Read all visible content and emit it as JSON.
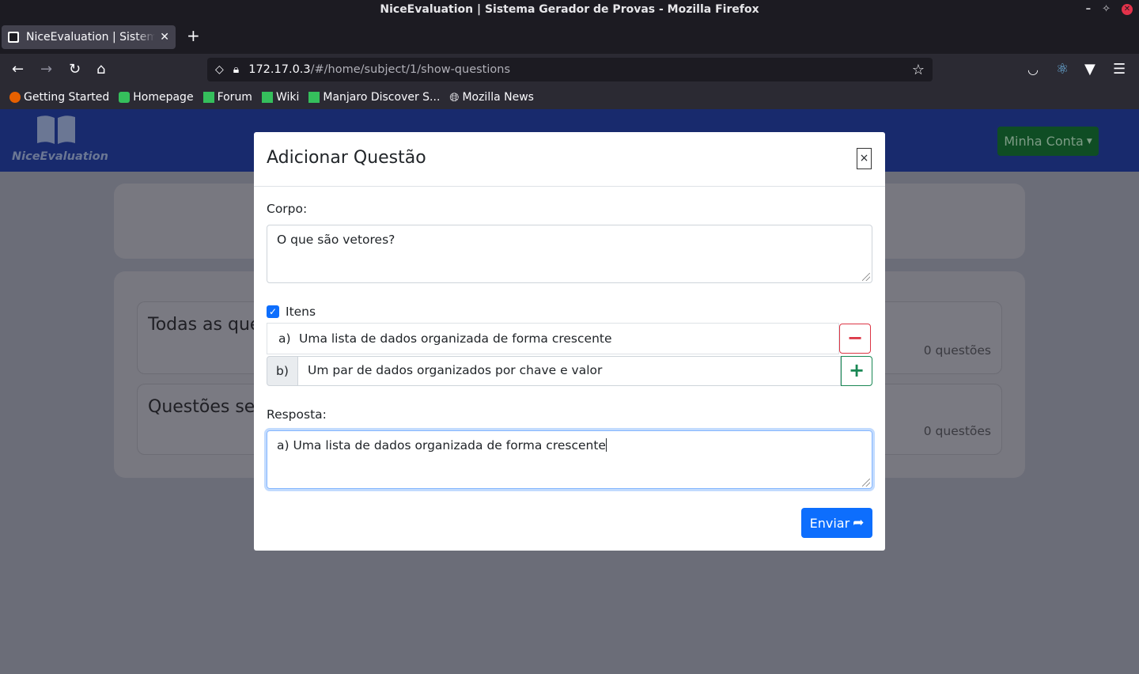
{
  "window": {
    "title": "NiceEvaluation | Sistema Gerador de Provas - Mozilla Firefox"
  },
  "browser": {
    "tab_title": "NiceEvaluation | Sistema Gerador de Provas",
    "url_host": "172.17.0.3",
    "url_path": "/#/home/subject/1/show-questions",
    "bookmarks": [
      {
        "label": "Getting Started",
        "icon": "firefox-icon"
      },
      {
        "label": "Homepage",
        "icon": "manjaro-icon"
      },
      {
        "label": "Forum",
        "icon": "manjaro-icon"
      },
      {
        "label": "Wiki",
        "icon": "manjaro-icon"
      },
      {
        "label": "Manjaro Discover S...",
        "icon": "manjaro-icon"
      },
      {
        "label": "Mozilla News",
        "icon": "globe-icon"
      }
    ]
  },
  "app": {
    "brand": "NiceEvaluation",
    "account_label": "Minha Conta",
    "cards": [
      {
        "title": "Todas as que",
        "count": "0 questões"
      },
      {
        "title": "Questões ser",
        "count": "0 questões"
      }
    ]
  },
  "modal": {
    "title": "Adicionar Questão",
    "close_label": "×",
    "body_label": "Corpo:",
    "body_value": "O que são vetores?",
    "items_label": "Itens",
    "items": [
      {
        "letter": "a)",
        "text": "Uma lista de dados organizada de forma crescente"
      }
    ],
    "new_item": {
      "letter": "b)",
      "value": "Um par de dados organizados por chave e valor"
    },
    "answer_label": "Resposta:",
    "answer_value": "a) Uma lista de dados organizada de forma crescente",
    "submit_label": "Enviar"
  },
  "colors": {
    "header_bg": "#182a6d",
    "primary": "#0d6efd",
    "danger": "#dc3545",
    "success": "#198754",
    "account_btn": "#0f4d24"
  }
}
